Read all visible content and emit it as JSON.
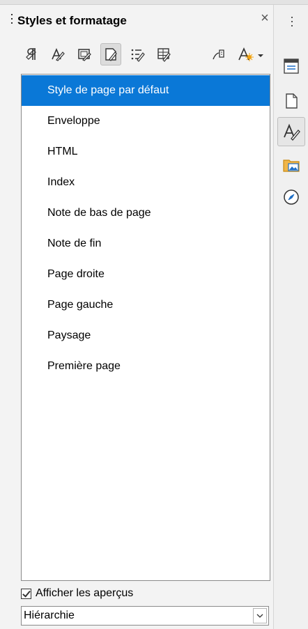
{
  "panel": {
    "title": "Styles et formatage",
    "close_glyph": "×",
    "category_buttons": [
      {
        "icon": "paragraph-styles-icon",
        "active": false
      },
      {
        "icon": "character-styles-icon",
        "active": false
      },
      {
        "icon": "frame-styles-icon",
        "active": false
      },
      {
        "icon": "page-styles-icon",
        "active": true
      },
      {
        "icon": "list-styles-icon",
        "active": false
      },
      {
        "icon": "table-styles-icon",
        "active": false
      }
    ],
    "right_buttons": [
      {
        "icon": "fill-format-mode-icon"
      },
      {
        "icon": "new-style-menu-icon"
      }
    ],
    "styles": [
      "Style de page par défaut",
      "Enveloppe",
      "HTML",
      "Index",
      "Note de bas de page",
      "Note de fin",
      "Page droite",
      "Page gauche",
      "Paysage",
      "Première page"
    ],
    "selected_index": 0,
    "show_previews_label": "Afficher les aperçus",
    "show_previews_checked": true,
    "filter_value": "Hiérarchie"
  },
  "sidebar_tabs": [
    {
      "icon": "properties-icon",
      "active": false
    },
    {
      "icon": "page-icon",
      "active": false
    },
    {
      "icon": "styles-icon",
      "active": true
    },
    {
      "icon": "gallery-icon",
      "active": false
    },
    {
      "icon": "navigator-icon",
      "active": false
    }
  ],
  "colors": {
    "selection": "#0a78d7",
    "panel_bg": "#f3f3f3"
  }
}
